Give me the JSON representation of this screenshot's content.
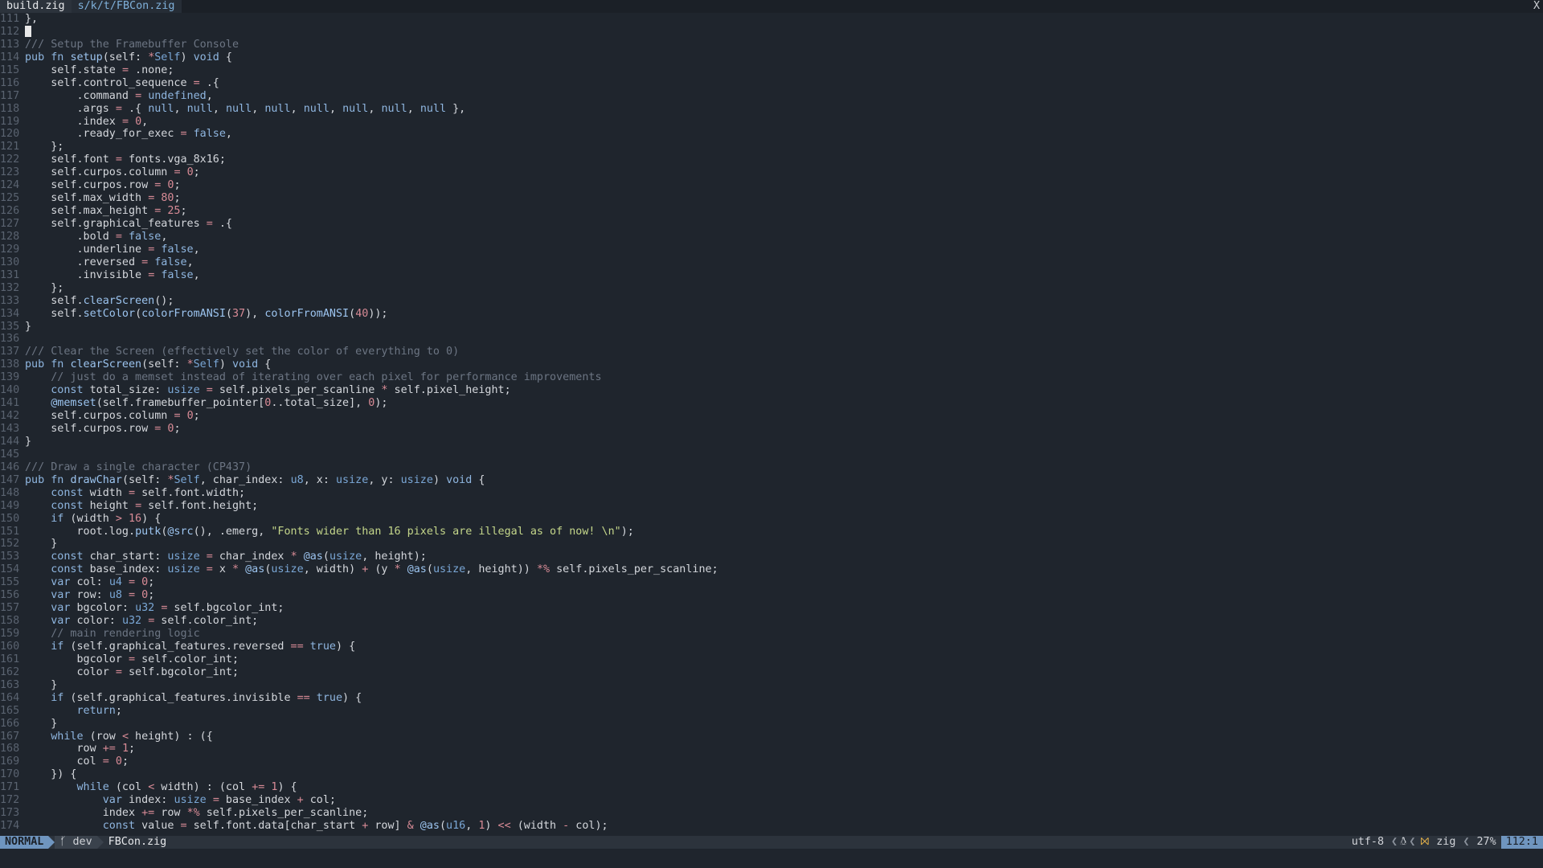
{
  "tabline": {
    "tabs": [
      {
        "label": "build.zig",
        "active": true
      },
      {
        "label": "s/k/t/FBCon.zig",
        "active": false
      }
    ],
    "close_label": "X"
  },
  "editor": {
    "cursor_line": "112",
    "lines": [
      {
        "n": "111",
        "t": "},"
      },
      {
        "n": "112",
        "t": ""
      },
      {
        "n": "113",
        "t": "/// Setup the Framebuffer Console"
      },
      {
        "n": "114",
        "t": "pub fn setup(self: *Self) void {"
      },
      {
        "n": "115",
        "t": "    self.state = .none;"
      },
      {
        "n": "116",
        "t": "    self.control_sequence = .{"
      },
      {
        "n": "117",
        "t": "        .command = undefined,"
      },
      {
        "n": "118",
        "t": "        .args = .{ null, null, null, null, null, null, null, null },"
      },
      {
        "n": "119",
        "t": "        .index = 0,"
      },
      {
        "n": "120",
        "t": "        .ready_for_exec = false,"
      },
      {
        "n": "121",
        "t": "    };"
      },
      {
        "n": "122",
        "t": "    self.font = fonts.vga_8x16;"
      },
      {
        "n": "123",
        "t": "    self.curpos.column = 0;"
      },
      {
        "n": "124",
        "t": "    self.curpos.row = 0;"
      },
      {
        "n": "125",
        "t": "    self.max_width = 80;"
      },
      {
        "n": "126",
        "t": "    self.max_height = 25;"
      },
      {
        "n": "127",
        "t": "    self.graphical_features = .{"
      },
      {
        "n": "128",
        "t": "        .bold = false,"
      },
      {
        "n": "129",
        "t": "        .underline = false,"
      },
      {
        "n": "130",
        "t": "        .reversed = false,"
      },
      {
        "n": "131",
        "t": "        .invisible = false,"
      },
      {
        "n": "132",
        "t": "    };"
      },
      {
        "n": "133",
        "t": "    self.clearScreen();"
      },
      {
        "n": "134",
        "t": "    self.setColor(colorFromANSI(37), colorFromANSI(40));"
      },
      {
        "n": "135",
        "t": "}"
      },
      {
        "n": "136",
        "t": ""
      },
      {
        "n": "137",
        "t": "/// Clear the Screen (effectively set the color of everything to 0)"
      },
      {
        "n": "138",
        "t": "pub fn clearScreen(self: *Self) void {"
      },
      {
        "n": "139",
        "t": "    // just do a memset instead of iterating over each pixel for performance improvements"
      },
      {
        "n": "140",
        "t": "    const total_size: usize = self.pixels_per_scanline * self.pixel_height;"
      },
      {
        "n": "141",
        "t": "    @memset(self.framebuffer_pointer[0..total_size], 0);"
      },
      {
        "n": "142",
        "t": "    self.curpos.column = 0;"
      },
      {
        "n": "143",
        "t": "    self.curpos.row = 0;"
      },
      {
        "n": "144",
        "t": "}"
      },
      {
        "n": "145",
        "t": ""
      },
      {
        "n": "146",
        "t": "/// Draw a single character (CP437)"
      },
      {
        "n": "147",
        "t": "pub fn drawChar(self: *Self, char_index: u8, x: usize, y: usize) void {"
      },
      {
        "n": "148",
        "t": "    const width = self.font.width;"
      },
      {
        "n": "149",
        "t": "    const height = self.font.height;"
      },
      {
        "n": "150",
        "t": "    if (width > 16) {"
      },
      {
        "n": "151",
        "t": "        root.log.putk(@src(), .emerg, \"Fonts wider than 16 pixels are illegal as of now! \\n\");"
      },
      {
        "n": "152",
        "t": "    }"
      },
      {
        "n": "153",
        "t": "    const char_start: usize = char_index * @as(usize, height);"
      },
      {
        "n": "154",
        "t": "    const base_index: usize = x * @as(usize, width) + (y * @as(usize, height)) *% self.pixels_per_scanline;"
      },
      {
        "n": "155",
        "t": "    var col: u4 = 0;"
      },
      {
        "n": "156",
        "t": "    var row: u8 = 0;"
      },
      {
        "n": "157",
        "t": "    var bgcolor: u32 = self.bgcolor_int;"
      },
      {
        "n": "158",
        "t": "    var color: u32 = self.color_int;"
      },
      {
        "n": "159",
        "t": "    // main rendering logic"
      },
      {
        "n": "160",
        "t": "    if (self.graphical_features.reversed == true) {"
      },
      {
        "n": "161",
        "t": "        bgcolor = self.color_int;"
      },
      {
        "n": "162",
        "t": "        color = self.bgcolor_int;"
      },
      {
        "n": "163",
        "t": "    }"
      },
      {
        "n": "164",
        "t": "    if (self.graphical_features.invisible == true) {"
      },
      {
        "n": "165",
        "t": "        return;"
      },
      {
        "n": "166",
        "t": "    }"
      },
      {
        "n": "167",
        "t": "    while (row < height) : ({"
      },
      {
        "n": "168",
        "t": "        row += 1;"
      },
      {
        "n": "169",
        "t": "        col = 0;"
      },
      {
        "n": "170",
        "t": "    }) {"
      },
      {
        "n": "171",
        "t": "        while (col < width) : (col += 1) {"
      },
      {
        "n": "172",
        "t": "            var index: usize = base_index + col;"
      },
      {
        "n": "173",
        "t": "            index += row *% self.pixels_per_scanline;"
      },
      {
        "n": "174",
        "t": "            const value = self.font.data[char_start + row] & @as(u16, 1) << (width - col);"
      }
    ]
  },
  "statusline": {
    "mode": "NORMAL",
    "branch_icon": "git-branch-icon",
    "branch": "dev",
    "file": "FBCon.zig",
    "encoding": "utf-8",
    "os_icon": "linux-icon",
    "filetype_icon": "zig-icon",
    "filetype": "zig",
    "percent": "27%",
    "position": "112:1"
  },
  "colors": {
    "background": "#1f252d",
    "mode_accent": "#6f95bf",
    "keyword": "#8fb6e0",
    "number": "#d88b96",
    "string": "#c4d68a",
    "comment": "#6c7583"
  }
}
